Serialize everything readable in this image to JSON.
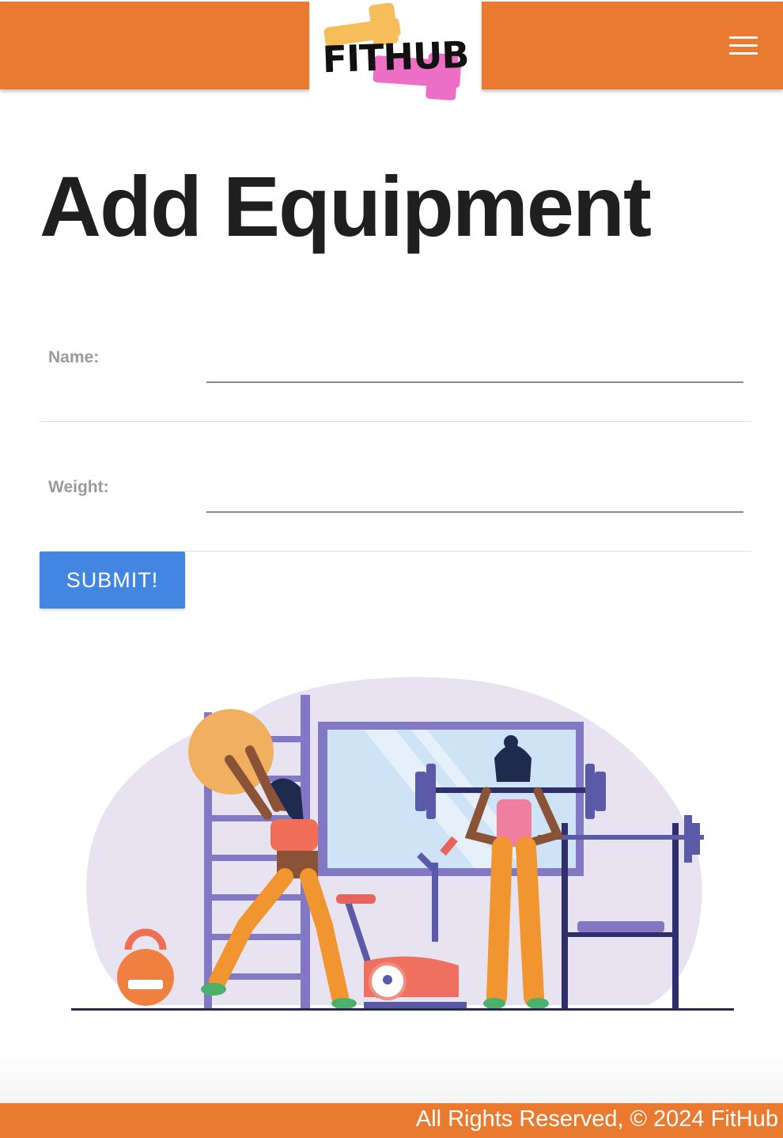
{
  "colors": {
    "brand": "#eb7a31",
    "button": "#4286e2",
    "logo_yellow": "#f5be5b",
    "logo_pink": "#ec6fc5"
  },
  "header": {
    "logo_text": "FITHUB",
    "menu_icon": "hamburger-menu-icon"
  },
  "page": {
    "title": "Add Equipment"
  },
  "form": {
    "fields": [
      {
        "label": "Name:",
        "value": "",
        "placeholder": ""
      },
      {
        "label": "Weight:",
        "value": "",
        "placeholder": ""
      }
    ],
    "submit_label": "SUBMIT!"
  },
  "illustration": {
    "icon": "gym-workout-illustration"
  },
  "footer": {
    "text": "All Rights Reserved, © 2024 FitHub"
  }
}
